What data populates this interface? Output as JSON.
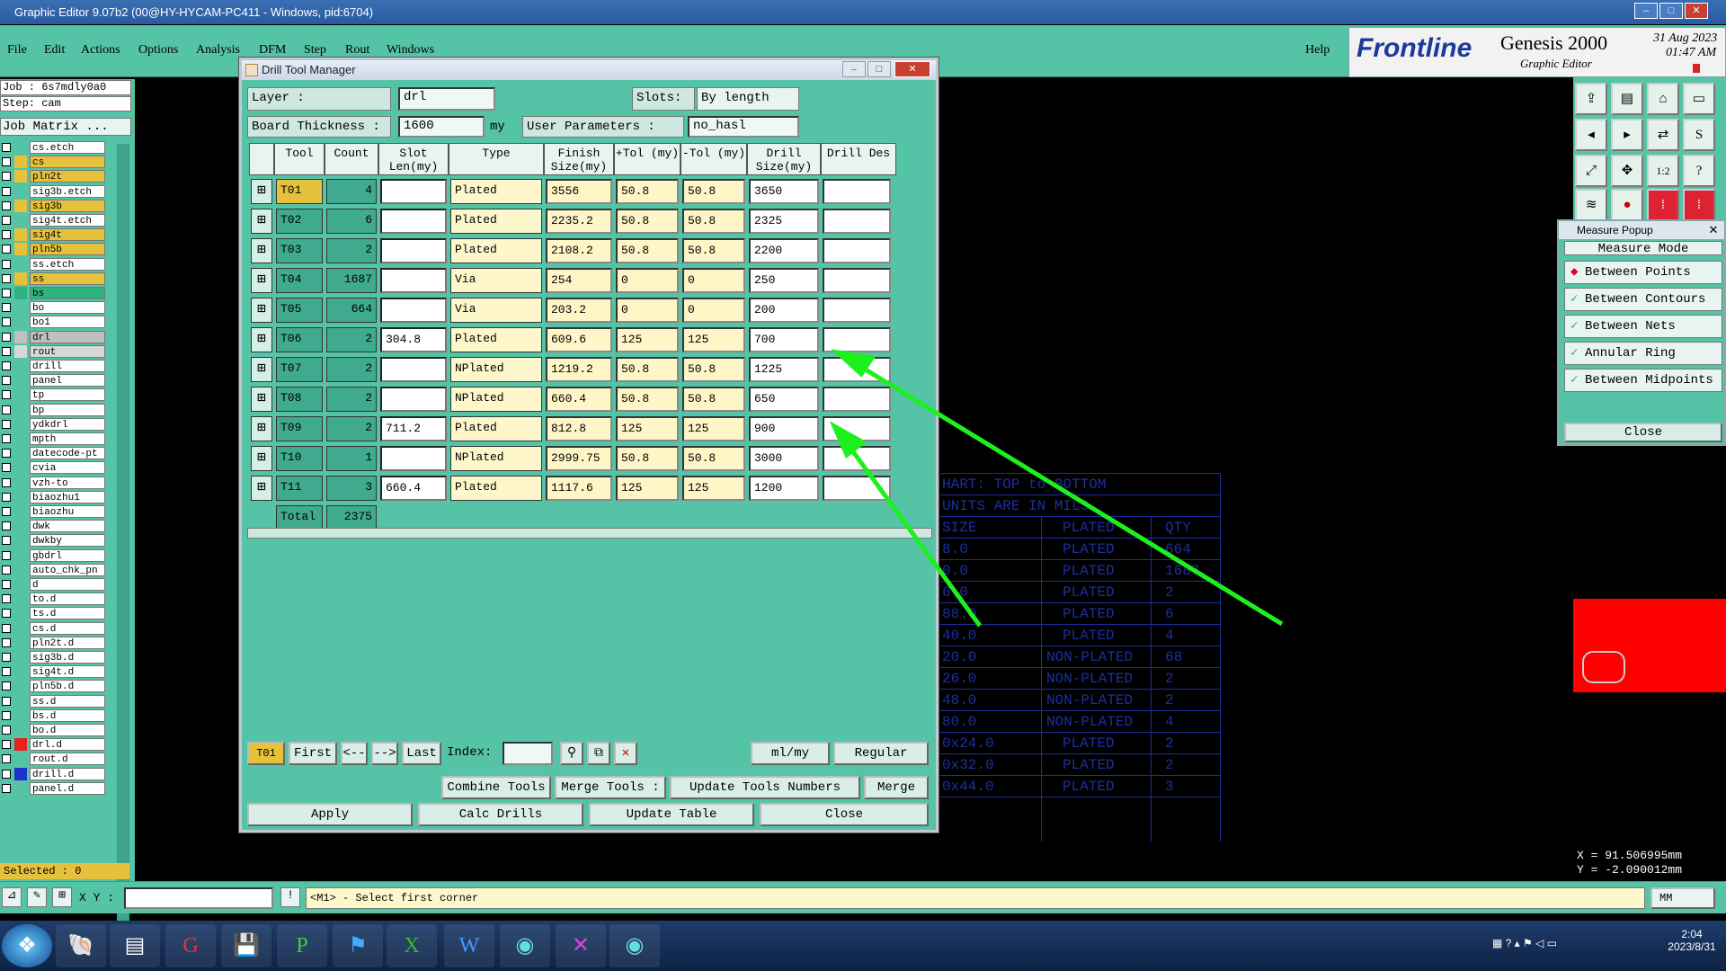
{
  "window": {
    "title": "Graphic Editor 9.07b2 (00@HY-HYCAM-PC411 - Windows, pid:6704)"
  },
  "menu": [
    "File",
    "Edit",
    "Actions",
    "Options",
    "Analysis",
    "DFM",
    "Step",
    "Rout",
    "Windows"
  ],
  "help": "Help",
  "brand": {
    "logo": "Frontline",
    "product": "Genesis 2000",
    "sub": "Graphic Editor",
    "date": "31 Aug 2023",
    "time": "01:47 AM"
  },
  "left": {
    "job": "Job : 6s7mdly0a0",
    "step": "Step: cam",
    "matrix": "Job Matrix ...",
    "selected": "Selected : 0",
    "layers": [
      {
        "name": "cs.etch",
        "color": "#fff"
      },
      {
        "name": "cs",
        "color": "#e6c23c"
      },
      {
        "name": "pln2t",
        "color": "#e6c23c"
      },
      {
        "name": "sig3b.etch",
        "color": "#fff"
      },
      {
        "name": "sig3b",
        "color": "#e6c23c"
      },
      {
        "name": "sig4t.etch",
        "color": "#fff"
      },
      {
        "name": "sig4t",
        "color": "#e6c23c"
      },
      {
        "name": "pln5b",
        "color": "#e6c23c"
      },
      {
        "name": "ss.etch",
        "color": "#fff"
      },
      {
        "name": "ss",
        "color": "#e6c23c"
      },
      {
        "name": "bs",
        "color": "#2fb37e"
      },
      {
        "name": "bo",
        "color": "#fff"
      },
      {
        "name": "bo1",
        "color": "#fff"
      },
      {
        "name": "drl",
        "color": "#c0c0c0"
      },
      {
        "name": "rout",
        "color": "#d8d8d8"
      },
      {
        "name": "drill",
        "color": "#fff"
      },
      {
        "name": "panel",
        "color": "#fff"
      },
      {
        "name": "tp",
        "color": "#fff"
      },
      {
        "name": "bp",
        "color": "#fff"
      },
      {
        "name": "ydkdrl",
        "color": "#fff"
      },
      {
        "name": "mpth",
        "color": "#fff"
      },
      {
        "name": "datecode-pt",
        "color": "#fff"
      },
      {
        "name": "cvia",
        "color": "#fff"
      },
      {
        "name": "vzh-to",
        "color": "#fff"
      },
      {
        "name": "biaozhu1",
        "color": "#fff"
      },
      {
        "name": "biaozhu",
        "color": "#fff"
      },
      {
        "name": "dwk",
        "color": "#fff"
      },
      {
        "name": "dwkby",
        "color": "#fff"
      },
      {
        "name": "gbdrl",
        "color": "#fff"
      },
      {
        "name": "auto_chk_pn",
        "color": "#fff"
      },
      {
        "name": "d",
        "color": "#fff"
      },
      {
        "name": "to.d",
        "color": "#fff"
      },
      {
        "name": "ts.d",
        "color": "#fff"
      },
      {
        "name": "cs.d",
        "color": "#fff"
      },
      {
        "name": "pln2t.d",
        "color": "#fff"
      },
      {
        "name": "sig3b.d",
        "color": "#fff"
      },
      {
        "name": "sig4t.d",
        "color": "#fff"
      },
      {
        "name": "pln5b.d",
        "color": "#fff"
      },
      {
        "name": "ss.d",
        "color": "#fff"
      },
      {
        "name": "bs.d",
        "color": "#fff"
      },
      {
        "name": "bo.d",
        "color": "#fff"
      },
      {
        "name": "drl.d",
        "color": "#e82020"
      },
      {
        "name": "rout.d",
        "color": "#fff"
      },
      {
        "name": "drill.d",
        "color": "#2030d0"
      },
      {
        "name": "panel.d",
        "color": "#fff"
      }
    ]
  },
  "dialog": {
    "title": "Drill Tool Manager",
    "layer_label": "Layer :",
    "layer_value": "drl",
    "slots_label": "Slots:",
    "slots_value": "By length",
    "thickness_label": "Board Thickness :",
    "thickness_value": "1600",
    "thickness_unit": "my",
    "userparam_label": "User Parameters :",
    "userparam_value": "no_hasl",
    "headers": [
      "Tool",
      "Count",
      "Slot Len(my)",
      "Type",
      "Finish Size(my)",
      "+Tol (my)",
      "-Tol (my)",
      "Drill Size(my)",
      "Drill Des"
    ],
    "rows": [
      {
        "tool": "T01",
        "count": "4",
        "slot": "",
        "type": "Plated",
        "finish": "3556",
        "ptol": "50.8",
        "ntol": "50.8",
        "drill": "3650",
        "des": ""
      },
      {
        "tool": "T02",
        "count": "6",
        "slot": "",
        "type": "Plated",
        "finish": "2235.2",
        "ptol": "50.8",
        "ntol": "50.8",
        "drill": "2325",
        "des": ""
      },
      {
        "tool": "T03",
        "count": "2",
        "slot": "",
        "type": "Plated",
        "finish": "2108.2",
        "ptol": "50.8",
        "ntol": "50.8",
        "drill": "2200",
        "des": ""
      },
      {
        "tool": "T04",
        "count": "1687",
        "slot": "",
        "type": "Via",
        "finish": "254",
        "ptol": "0",
        "ntol": "0",
        "drill": "250",
        "des": ""
      },
      {
        "tool": "T05",
        "count": "664",
        "slot": "",
        "type": "Via",
        "finish": "203.2",
        "ptol": "0",
        "ntol": "0",
        "drill": "200",
        "des": ""
      },
      {
        "tool": "T06",
        "count": "2",
        "slot": "304.8",
        "type": "Plated",
        "finish": "609.6",
        "ptol": "125",
        "ntol": "125",
        "drill": "700",
        "des": ""
      },
      {
        "tool": "T07",
        "count": "2",
        "slot": "",
        "type": "NPlated",
        "finish": "1219.2",
        "ptol": "50.8",
        "ntol": "50.8",
        "drill": "1225",
        "des": ""
      },
      {
        "tool": "T08",
        "count": "2",
        "slot": "",
        "type": "NPlated",
        "finish": "660.4",
        "ptol": "50.8",
        "ntol": "50.8",
        "drill": "650",
        "des": ""
      },
      {
        "tool": "T09",
        "count": "2",
        "slot": "711.2",
        "type": "Plated",
        "finish": "812.8",
        "ptol": "125",
        "ntol": "125",
        "drill": "900",
        "des": ""
      },
      {
        "tool": "T10",
        "count": "1",
        "slot": "",
        "type": "NPlated",
        "finish": "2999.75",
        "ptol": "50.8",
        "ntol": "50.8",
        "drill": "3000",
        "des": ""
      },
      {
        "tool": "T11",
        "count": "3",
        "slot": "660.4",
        "type": "Plated",
        "finish": "1117.6",
        "ptol": "125",
        "ntol": "125",
        "drill": "1200",
        "des": ""
      }
    ],
    "total_label": "Total",
    "total_value": "2375",
    "nav": {
      "current": "T01",
      "first": "First",
      "prev": "<--",
      "next": "-->",
      "last": "Last",
      "index_label": "Index:",
      "index_value": "",
      "units": "ml/my",
      "mode": "Regular"
    },
    "actions": {
      "combine": "Combine Tools",
      "merge_tools": "Merge Tools :",
      "update_numbers": "Update Tools Numbers",
      "merge": "Merge"
    },
    "bottom": {
      "apply": "Apply",
      "calc": "Calc Drills",
      "update": "Update Table",
      "close": "Close"
    }
  },
  "measure": {
    "title": "Measure Popup",
    "mode_label": "Measure Mode",
    "options": [
      "Between Points",
      "Between Contours",
      "Between Nets",
      "Annular Ring",
      "Between Midpoints"
    ],
    "close": "Close"
  },
  "chart_overlay": {
    "title": "HART: TOP to BOTTOM",
    "units": "UNITS ARE IN MILS",
    "headers": [
      "SIZE",
      "PLATED",
      "QTY"
    ],
    "rows": [
      [
        "8.0",
        "PLATED",
        "664"
      ],
      [
        "0.0",
        "PLATED",
        "1687"
      ],
      [
        "6.0",
        "PLATED",
        "2"
      ],
      [
        "88.0",
        "PLATED",
        "6"
      ],
      [
        "40.0",
        "PLATED",
        "4"
      ],
      [
        "20.0",
        "NON-PLATED",
        "68"
      ],
      [
        "26.0",
        "NON-PLATED",
        "2"
      ],
      [
        "48.0",
        "NON-PLATED",
        "2"
      ],
      [
        "80.0",
        "NON-PLATED",
        "4"
      ],
      [
        "0x24.0",
        "PLATED",
        "2"
      ],
      [
        "0x32.0",
        "PLATED",
        "2"
      ],
      [
        "0x44.0",
        "PLATED",
        "3"
      ]
    ]
  },
  "coords": {
    "x": "X = 91.506995mm",
    "y": "Y = -2.090012mm"
  },
  "status": {
    "xy_label": "X Y :",
    "message": "<M1> - Select first corner",
    "unit": "MM"
  },
  "taskbar": {
    "time": "2:04",
    "date": "2023/8/31"
  }
}
